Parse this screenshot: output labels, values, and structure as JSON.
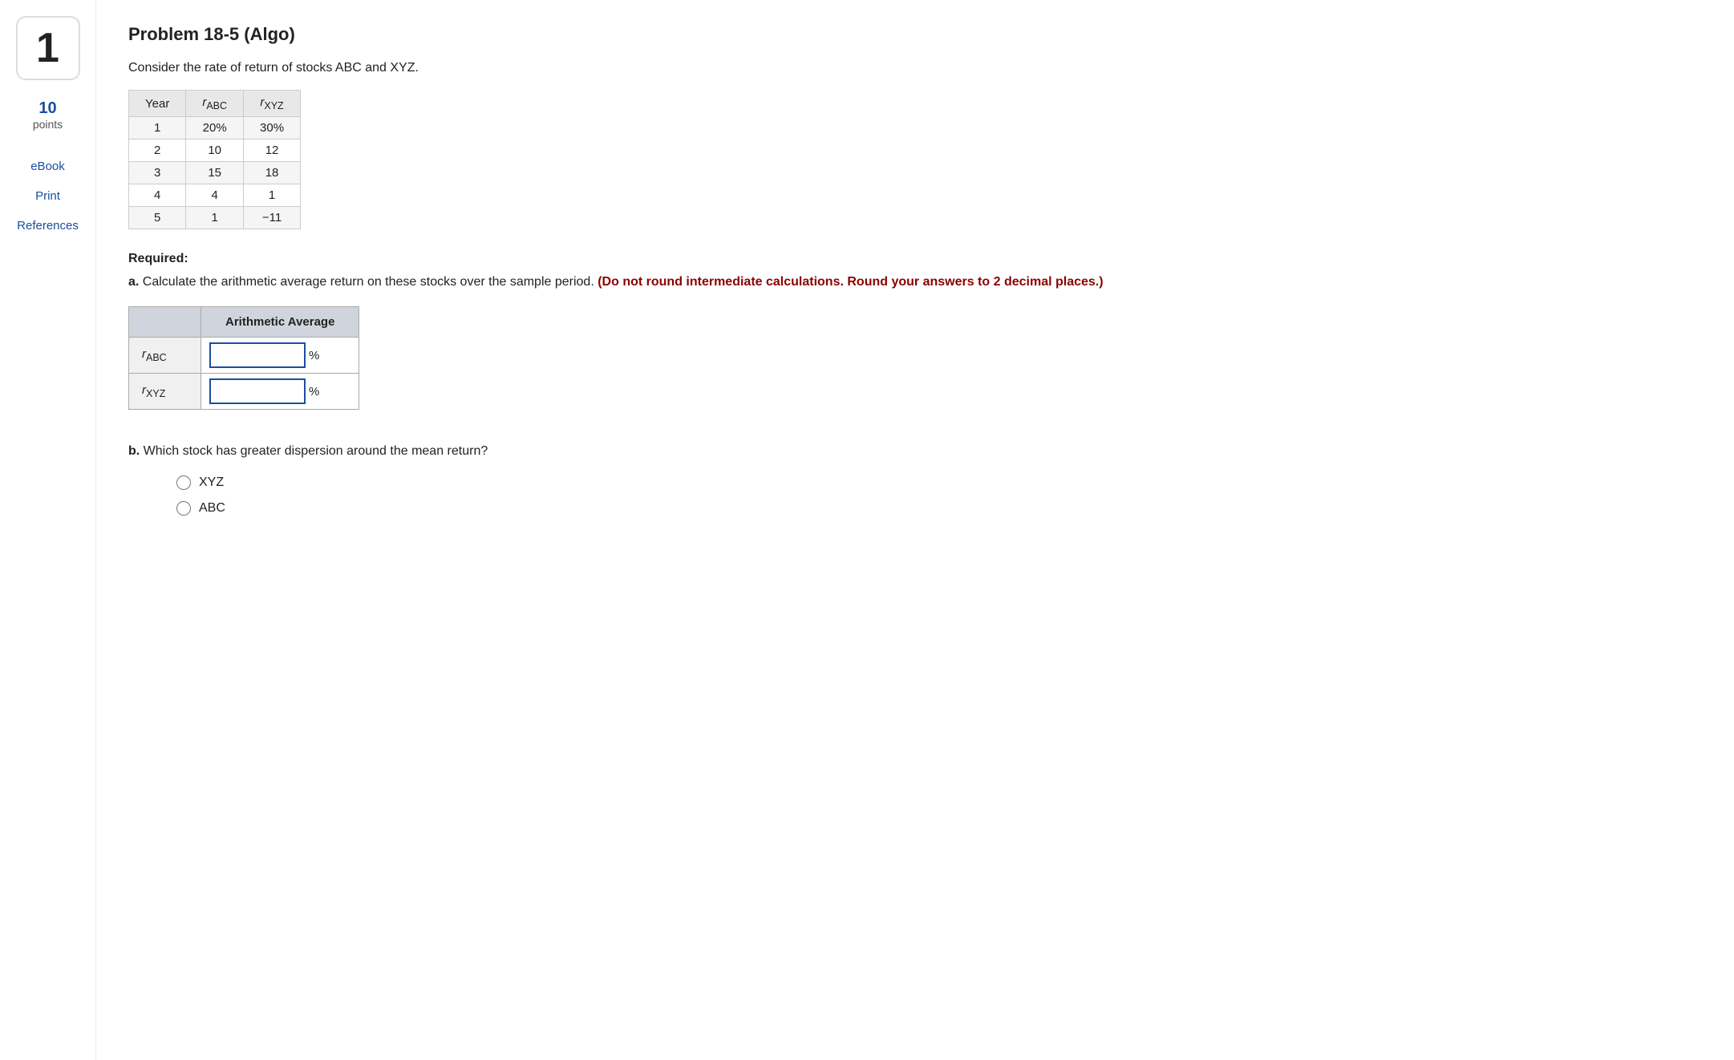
{
  "sidebar": {
    "question_number": "1",
    "points_value": "10",
    "points_label": "points",
    "links": [
      {
        "id": "ebook",
        "label": "eBook"
      },
      {
        "id": "print",
        "label": "Print"
      },
      {
        "id": "references",
        "label": "References"
      }
    ]
  },
  "problem": {
    "title": "Problem 18-5 (Algo)",
    "intro": "Consider the rate of return of stocks ABC and XYZ.",
    "table": {
      "headers": [
        "Year",
        "rABC",
        "rXYZ"
      ],
      "rows": [
        [
          "1",
          "20%",
          "30%"
        ],
        [
          "2",
          "10",
          "12"
        ],
        [
          "3",
          "15",
          "18"
        ],
        [
          "4",
          "4",
          "1"
        ],
        [
          "5",
          "1",
          "−11"
        ]
      ]
    },
    "required_label": "Required:",
    "part_a": {
      "label": "a.",
      "text": "Calculate the arithmetic average return on these stocks over the sample period.",
      "red_text": "(Do not round intermediate calculations. Round your answers to 2 decimal places.)",
      "answer_table": {
        "header": "Arithmetic Average",
        "rows": [
          {
            "label": "rABC",
            "superscript": "",
            "placeholder": ""
          },
          {
            "label": "rXYZ",
            "superscript": "",
            "placeholder": ""
          }
        ],
        "pct_symbol": "%"
      }
    },
    "part_b": {
      "label": "b.",
      "text": "Which stock has greater dispersion around the mean return?",
      "options": [
        {
          "id": "xyz",
          "label": "XYZ"
        },
        {
          "id": "abc",
          "label": "ABC"
        }
      ]
    }
  }
}
